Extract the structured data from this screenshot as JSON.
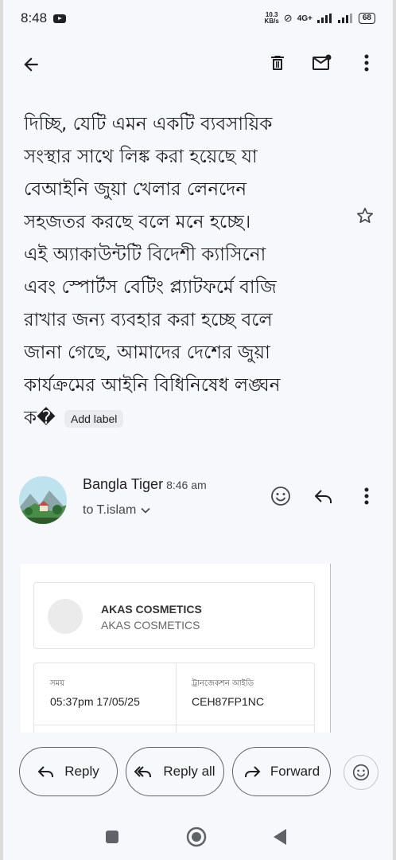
{
  "status_bar": {
    "time": "8:48",
    "net_speed_top": "10.3",
    "net_speed_unit": "KB/s",
    "signal_label": "4G+",
    "battery": "68"
  },
  "toolbar": {
    "icons": [
      "back-arrow-icon",
      "delete-icon",
      "mark-unread-icon",
      "more-vert-icon"
    ]
  },
  "email_body": {
    "lines": [
      "দিচ্ছি, যেটি এমন একটি ব্যবসায়িক",
      "সংস্থার সাথে লিঙ্ক করা হয়েছে যা",
      "বেআইনি জুয়া খেলার লেনদেন",
      "সহজতর করছে বলে মনে হচ্ছে।",
      "এই অ্যাকাউন্টটি বিদেশী ক্যাসিনো",
      "এবং স্পোর্টস বেটিং প্ল্যাটফর্মে বাজি",
      "রাখার জন্য ব্যবহার করা হচ্ছে বলে",
      "জানা গেছে, আমাদের দেশের জুয়া",
      "কার্যক্রমের আইনি বিধিনিষেধ লঙ্ঘন"
    ],
    "last_line": "ক�",
    "add_label": "Add label"
  },
  "sender": {
    "name": "Bangla Tiger",
    "time": "8:46 am",
    "to": "to T.islam"
  },
  "receipt": {
    "merchant_name": "AKAS COSMETICS",
    "merchant_sub": "AKAS COSMETICS",
    "time_label": "সময়",
    "time_value": "05:37pm 17/05/25",
    "txn_label": "ট্রানজেকশন আইডি",
    "txn_value": "CEH87FP1NC"
  },
  "actions": {
    "reply": "Reply",
    "reply_all": "Reply all",
    "forward": "Forward"
  },
  "colors": {
    "background": "#f6f8fc",
    "text": "#1f1f1f",
    "outline": "#5f6368"
  }
}
